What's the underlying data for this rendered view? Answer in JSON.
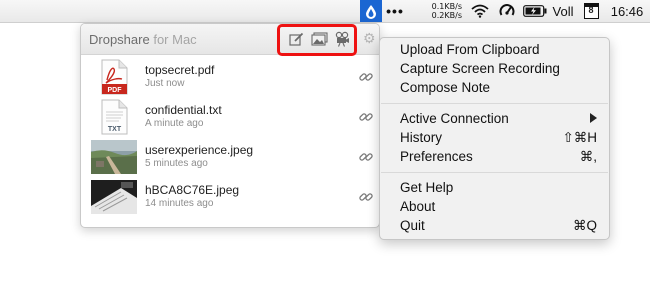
{
  "menubar": {
    "net_up": "0.1KB/s",
    "net_down": "0.2KB/s",
    "volume": "Voll",
    "calendar_day": "8",
    "clock": "16:46"
  },
  "panel": {
    "app_name": "Dropshare",
    "app_suffix": "for Mac",
    "files": [
      {
        "name": "topsecret.pdf",
        "time": "Just now",
        "type": "pdf",
        "badge": "PDF"
      },
      {
        "name": "confidential.txt",
        "time": "A minute ago",
        "type": "txt",
        "badge": "TXT"
      },
      {
        "name": "userexperience.jpeg",
        "time": "5 minutes ago",
        "type": "image-landscape"
      },
      {
        "name": "hBCA8C76E.jpeg",
        "time": "14 minutes ago",
        "type": "image-bw"
      }
    ]
  },
  "menu": {
    "items": [
      {
        "label": "Upload From Clipboard"
      },
      {
        "label": "Capture Screen Recording"
      },
      {
        "label": "Compose Note"
      },
      {
        "label": "Active Connection",
        "submenu": true
      },
      {
        "label": "History",
        "shortcut": "⇧⌘H"
      },
      {
        "label": "Preferences",
        "shortcut": "⌘,"
      },
      {
        "label": "Get Help"
      },
      {
        "label": "About"
      },
      {
        "label": "Quit",
        "shortcut": "⌘Q"
      }
    ]
  },
  "colors": {
    "highlight": "#ee1111",
    "dropshare_blue": "#1b66d2",
    "pdf_red": "#c8281e"
  },
  "icons": {
    "header": [
      "compose-note-icon",
      "image-upload-icon",
      "screen-recording-icon",
      "settings-gear-icon"
    ],
    "row_action": "link-icon"
  }
}
